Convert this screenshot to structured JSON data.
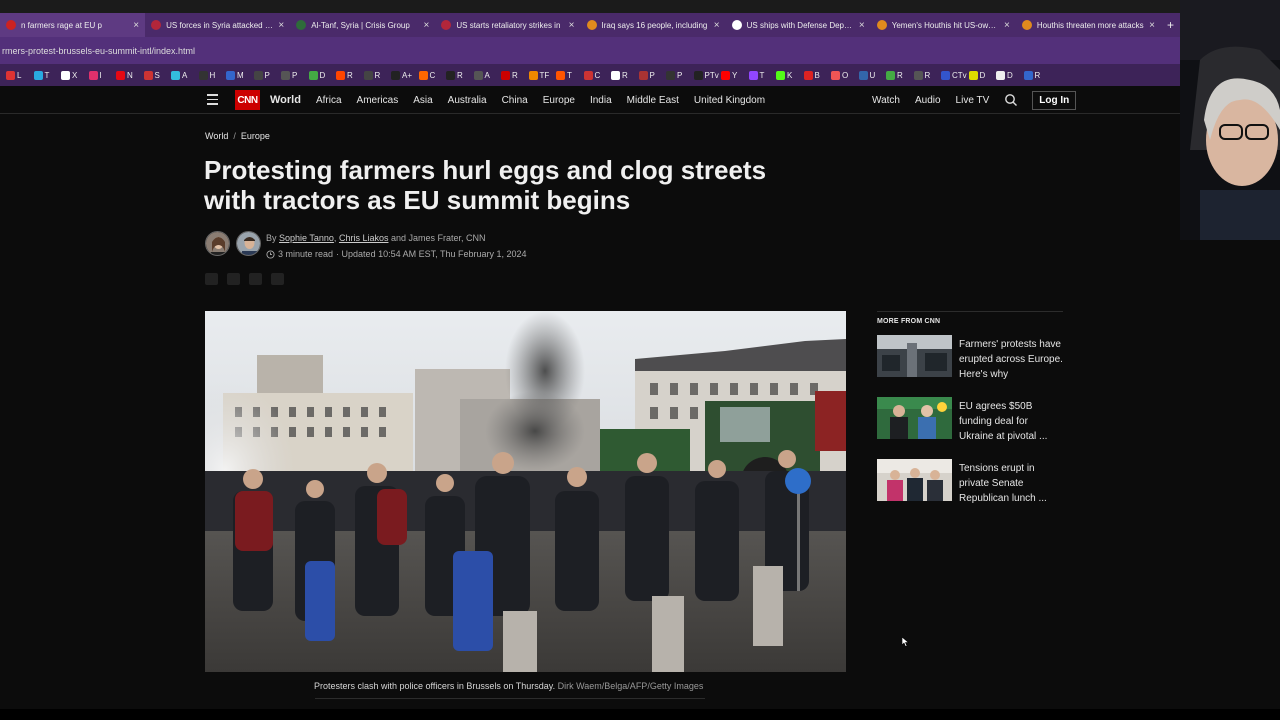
{
  "browser": {
    "tabs": [
      {
        "label": "n farmers rage at EU p",
        "color": "#cc2222"
      },
      {
        "label": "US forces in Syria attacked fou",
        "color": "#b3263a"
      },
      {
        "label": "Al-Tanf, Syria | Crisis Group",
        "color": "#2e6b3a"
      },
      {
        "label": "US starts retaliatory strikes in",
        "color": "#b3263a"
      },
      {
        "label": "Iraq says 16 people, including",
        "color": "#e08a1e"
      },
      {
        "label": "US ships with Defense Departm",
        "color": "#ffffff"
      },
      {
        "label": "Yemen's Houthis hit US-owned",
        "color": "#e08a1e"
      },
      {
        "label": "Houthis threaten more attacks",
        "color": "#e08a1e"
      }
    ],
    "tab_close": "×",
    "new_tab": "+",
    "url": "rmers-protest-brussels-eu-summit-intl/index.html",
    "bookmarks": [
      {
        "label": "L",
        "color": "#d33"
      },
      {
        "label": "T",
        "color": "#29a9e1"
      },
      {
        "label": "X",
        "color": "#fff"
      },
      {
        "label": "I",
        "color": "#e1306c"
      },
      {
        "label": "N",
        "color": "#e50914"
      },
      {
        "label": "S",
        "color": "#c33"
      },
      {
        "label": "A",
        "color": "#3bd"
      },
      {
        "label": "H",
        "color": "#333"
      },
      {
        "label": "M",
        "color": "#36c"
      },
      {
        "label": "P",
        "color": "#444"
      },
      {
        "label": "P",
        "color": "#555"
      },
      {
        "label": "D",
        "color": "#4a4"
      },
      {
        "label": "R",
        "color": "#ff4500"
      },
      {
        "label": "R",
        "color": "#444"
      },
      {
        "label": "A+",
        "color": "#222"
      },
      {
        "label": "C",
        "color": "#f60"
      },
      {
        "label": "R",
        "color": "#222"
      },
      {
        "label": "A",
        "color": "#555"
      },
      {
        "label": "R",
        "color": "#c00"
      },
      {
        "label": "TF",
        "color": "#e80"
      },
      {
        "label": "T",
        "color": "#f50"
      },
      {
        "label": "C",
        "color": "#c33"
      },
      {
        "label": "R",
        "color": "#fff"
      },
      {
        "label": "P",
        "color": "#a33"
      },
      {
        "label": "P",
        "color": "#333"
      },
      {
        "label": "PTv",
        "color": "#222"
      },
      {
        "label": "Y",
        "color": "#f00"
      },
      {
        "label": "T",
        "color": "#9146ff"
      },
      {
        "label": "K",
        "color": "#53fc18"
      },
      {
        "label": "B",
        "color": "#d22"
      },
      {
        "label": "O",
        "color": "#e55"
      },
      {
        "label": "U",
        "color": "#36a"
      },
      {
        "label": "R",
        "color": "#4a4"
      },
      {
        "label": "R",
        "color": "#555"
      },
      {
        "label": "CTv",
        "color": "#35c"
      },
      {
        "label": "D",
        "color": "#dd0"
      },
      {
        "label": "D",
        "color": "#eee"
      },
      {
        "label": "R",
        "color": "#36c"
      }
    ]
  },
  "nav": {
    "logo": "CNN",
    "section": "World",
    "links": [
      "Africa",
      "Americas",
      "Asia",
      "Australia",
      "China",
      "Europe",
      "India",
      "Middle East",
      "United Kingdom"
    ],
    "right_links": [
      "Watch",
      "Audio",
      "Live TV"
    ],
    "login": "Log In"
  },
  "article": {
    "breadcrumb": [
      "World",
      "Europe"
    ],
    "breadcrumb_sep": "/",
    "headline": "Protesting farmers hurl eggs and clog streets with tractors as EU summit begins",
    "byline_prefix": "By",
    "authors": [
      "Sophie Tanno",
      "Chris Liakos"
    ],
    "byline_comma": ",",
    "byline_and": "and James Frater, CNN",
    "read_time": "3 minute read",
    "updated": "· Updated 10:54 AM EST, Thu February 1, 2024",
    "caption": "Protesters clash with police officers in Brussels on Thursday.",
    "caption_credit": "Dirk Waem/Belga/AFP/Getty Images"
  },
  "rail": {
    "title": "MORE FROM CNN",
    "items": [
      {
        "text": "Farmers' protests have erupted across Europe. Here's why"
      },
      {
        "text": "EU agrees $50B funding deal for Ukraine at pivotal ..."
      },
      {
        "text": "Tensions erupt in private Senate Republican lunch ..."
      }
    ]
  }
}
